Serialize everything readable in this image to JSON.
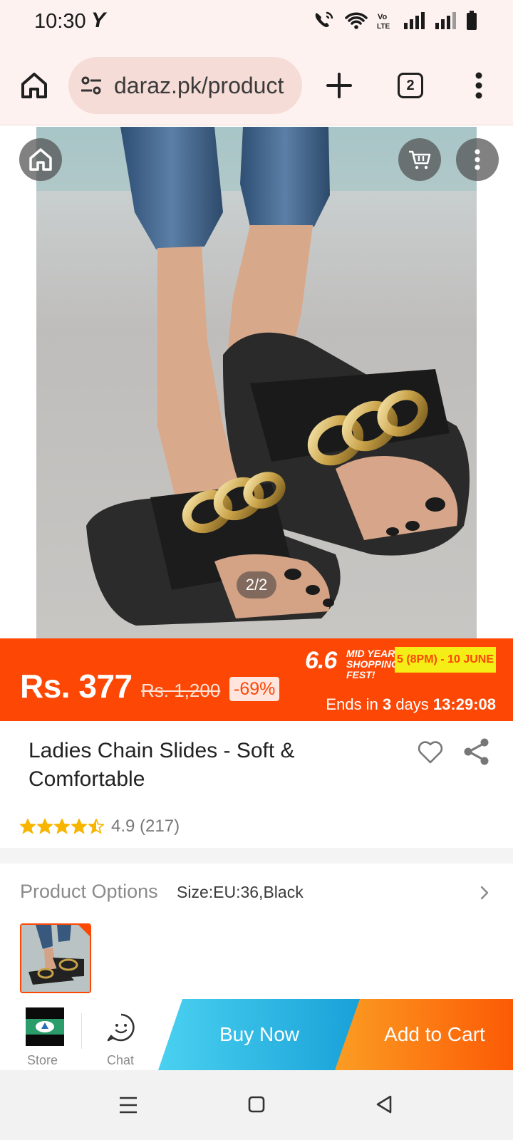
{
  "status_bar": {
    "time": "10:30",
    "carrier_glyph": "Y",
    "icons": [
      "wifi-calling-icon",
      "wifi-icon",
      "volte-icon",
      "signal-icon",
      "signal-icon",
      "battery-icon"
    ],
    "volte_label": "Vo LTE"
  },
  "browser": {
    "url": "daraz.pk/product",
    "tab_count": "2",
    "icons": [
      "home-icon",
      "site-settings-icon",
      "new-tab-icon",
      "tabs-icon",
      "overflow-menu-icon"
    ]
  },
  "gallery": {
    "counter": "2/2",
    "icons": [
      "home-icon",
      "cart-icon",
      "more-icon"
    ]
  },
  "price": {
    "current": "Rs. 377",
    "original": "Rs. 1,200",
    "discount": "-69%"
  },
  "promo": {
    "big": "6.6",
    "sub": "MID YEAR SHOPPING FEST!",
    "dates": "5 (8PM) - 10 JUNE",
    "ends_prefix": "Ends in",
    "ends_days": "3",
    "ends_days_label": "days",
    "ends_time": "13:29:08"
  },
  "product": {
    "title": "Ladies Chain Slides - Soft & Comfortable",
    "rating": "4.9",
    "reviews": "(217)",
    "stars_filled": 4.5,
    "stars_total": 5
  },
  "options": {
    "label": "Product Options",
    "value": "Size:EU:36,Black"
  },
  "actions": {
    "store_label": "Store",
    "chat_label": "Chat",
    "buy_now": "Buy Now",
    "add_to_cart": "Add to Cart"
  },
  "colors": {
    "brand_orange": "#fc4705",
    "buy_now_blue": "#19a1d8",
    "promo_yellow": "#f5ee16",
    "star": "#f7b500"
  }
}
